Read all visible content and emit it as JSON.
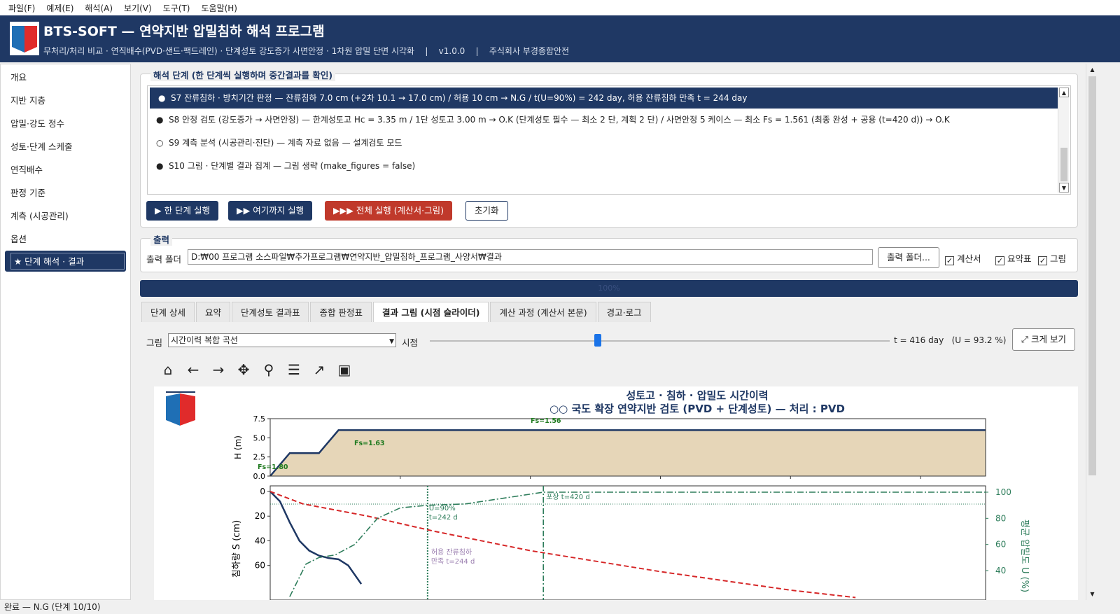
{
  "menu": [
    "파일(F)",
    "예제(E)",
    "해석(A)",
    "보기(V)",
    "도구(T)",
    "도움말(H)"
  ],
  "header": {
    "title": "BTS-SOFT — 연약지반 압밀침하 해석 프로그램",
    "subtitle": "무처리/처리 비교 · 연직배수(PVD·샌드·팩드레인) · 단계성토 강도증가 사면안정 · 1차원 압밀 단면 시각화    |    v1.0.0    |    주식회사 부경종합안전"
  },
  "sidebar": {
    "items": [
      "개요",
      "지반 지층",
      "압밀·강도 정수",
      "성토·단계 스케줄",
      "연직배수",
      "판정 기준",
      "계측 (시공관리)",
      "옵션"
    ],
    "active": "★ 단계 해석 · 결과"
  },
  "steps": {
    "group_title": "해석 단계 (한 단계씩 실행하며 중간결과를 확인)",
    "rows": [
      {
        "bullet": "●",
        "text": "S7  잔류침하 · 방치기간 판정   —  잔류침하 7.0 cm (+2차 10.1 → 17.0 cm) / 허용 10 cm → N.G / t(U=90%) = 242 day, 허용 잔류침하 만족 t = 244 day"
      },
      {
        "bullet": "●",
        "text": "S8  안정 검토 (강도증가 → 사면안정)   —  한계성토고 Hc = 3.35 m / 1단 성토고 3.00 m → O.K (단계성토 필수 — 최소 2 단, 계획 2 단) / 사면안정 5 케이스 — 최소 Fs = 1.561 (최종 완성 + 공용 (t=420 d)) → O.K"
      },
      {
        "bullet": "○",
        "text": "S9  계측 분석 (시공관리·진단)   —  계측 자료 없음 — 설계검토 모드"
      },
      {
        "bullet": "●",
        "text": "S10  그림 · 단계별 결과 집계   —  그림 생략 (make_figures = false)"
      }
    ],
    "buttons": {
      "one": "▶ 한 단계 실행",
      "upto": "▶▶ 여기까지 실행",
      "all": "▶▶▶ 전체 실행 (계산서·그림)",
      "reset": "초기화"
    }
  },
  "output": {
    "group_title": "출력",
    "folder_label": "출력 폴더",
    "folder_value": "D:₩00 프로그램 소스파일₩추가프로그램₩연약지반_압밀침하_프로그램_사양서₩결과",
    "browse": "출력 폴더...",
    "checks": [
      "계산서",
      "요약표",
      "그림"
    ]
  },
  "progress": {
    "value": 100,
    "label": "100%"
  },
  "tabs": [
    "단계 상세",
    "요약",
    "단계성토 결과표",
    "종합 판정표",
    "결과 그림 (시점 슬라이더)",
    "계산 과정 (계산서 본문)",
    "경고·로그"
  ],
  "active_tab": 4,
  "figure_panel": {
    "figure_label": "그림",
    "figure_select": "시간이력 복합 곡선",
    "time_label": "시점",
    "time_readout": "t = 416 day   (U = 93.2 %)",
    "expand": "⤢ 크게 보기",
    "slider_fraction": 0.38
  },
  "toolbar_icons": [
    "home-icon",
    "back-icon",
    "forward-icon",
    "pan-icon",
    "zoom-icon",
    "subplots-icon",
    "edit-axes-icon",
    "save-icon"
  ],
  "chart_data": {
    "type": "line",
    "title": "성토고 · 침하 · 압밀도 시간이력",
    "subtitle": "○○ 국도 확장 연약지반 검토 (PVD + 단계성토) — 처리 : PVD",
    "top": {
      "ylabel": "H (m)",
      "ylim": [
        0,
        7.5
      ],
      "yticks": [
        "0.0",
        "2.5",
        "5.0",
        "7.5"
      ],
      "series": [
        {
          "x": [
            0,
            30,
            75,
            105,
            1100
          ],
          "y": [
            0,
            3,
            3,
            6,
            6
          ]
        }
      ],
      "annotations": [
        "Fs=1.80",
        "Fs=1.63",
        "Fs=1.56"
      ]
    },
    "bottom": {
      "ylabel": "침하량 S (cm)",
      "y2label": "평균 압밀도 U (%)",
      "yticks": [
        "0",
        "20",
        "40",
        "60"
      ],
      "y2ticks": [
        "40",
        "60",
        "80",
        "100"
      ],
      "series": [
        {
          "x": [
            0,
            15,
            30,
            45,
            60,
            75,
            90,
            105,
            120,
            140
          ],
          "y": [
            0,
            8,
            25,
            40,
            48,
            52,
            54,
            55,
            60,
            75
          ]
        },
        {
          "x": [
            0,
            50,
            150,
            250,
            400,
            600,
            800,
            900
          ],
          "y": [
            0,
            10,
            20,
            32,
            48,
            65,
            80,
            86
          ]
        },
        {
          "x": [
            30,
            55,
            75,
            100,
            130,
            165,
            200,
            242,
            300,
            420,
            1100
          ],
          "y": [
            20,
            45,
            50,
            52,
            60,
            80,
            88,
            90,
            91,
            100,
            100
          ]
        }
      ],
      "annotations": [
        "U=90%",
        "t=242 d",
        "허용 잔류침하",
        "만족 t=244 d",
        "포장 t=420 d"
      ]
    },
    "colors": {
      "embankment": "#1f3864",
      "fill": "#e6d6b8",
      "settlement": "#1f3864",
      "red": "#d62728",
      "green": "#2e7d5b"
    }
  },
  "status": "완료 — N.G (단계 10/10)"
}
